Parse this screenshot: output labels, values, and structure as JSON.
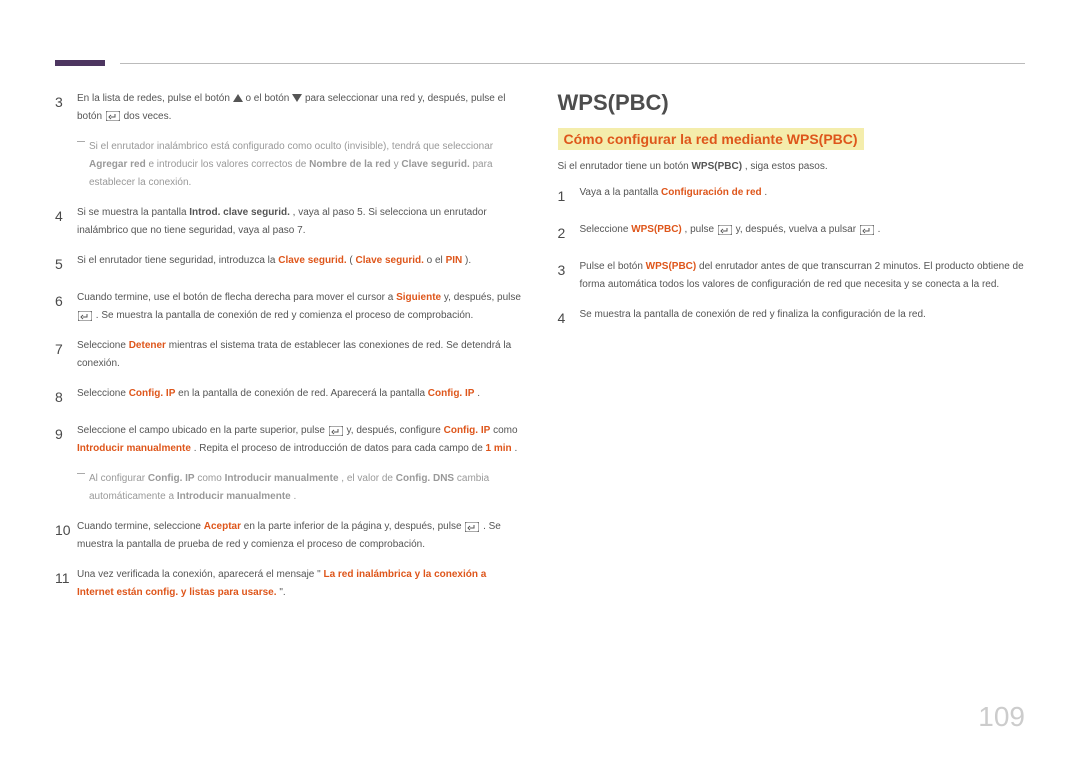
{
  "page_number": "109",
  "left": {
    "step3": {
      "pre": "En la lista de redes, pulse el botón ",
      "mid1": " o el botón ",
      "mid2": " para seleccionar una red y, después, pulse el botón ",
      "post": " dos veces."
    },
    "note1": {
      "pre": "Si el enrutador inalámbrico está configurado como oculto (invisible), tendrá que seleccionar ",
      "agregar": "Agregar red",
      "mid": " e introducir los valores correctos de ",
      "nombre": "Nombre de la red",
      "y": " y ",
      "clave": "Clave segurid.",
      "post": " para establecer la conexión."
    },
    "step4": {
      "pre": "Si se muestra la pantalla ",
      "introd": "Introd. clave segurid.",
      "post": ", vaya al paso 5. Si selecciona un enrutador inalámbrico que no tiene seguridad, vaya al paso 7."
    },
    "step5": {
      "pre": "Si el enrutador tiene seguridad, introduzca la ",
      "clave1": "Clave segurid.",
      "open": " (",
      "clave2": "Clave segurid.",
      "o": " o el ",
      "pin": "PIN",
      "close": ")."
    },
    "step6": {
      "pre": "Cuando termine, use el botón de flecha derecha para mover el cursor a ",
      "sig": "Siguiente",
      "post1": " y, después, pulse ",
      "post2": ". Se muestra la pantalla de conexión de red y comienza el proceso de comprobación."
    },
    "step7": {
      "pre": "Seleccione ",
      "det": "Detener",
      "post": " mientras el sistema trata de establecer las conexiones de red. Se detendrá la conexión."
    },
    "step8": {
      "pre": "Seleccione ",
      "cfg1": "Config. IP",
      "mid": " en la pantalla de conexión de red. Aparecerá la pantalla ",
      "cfg2": "Config. IP",
      "dot": "."
    },
    "step9": {
      "pre": "Seleccione el campo ubicado en la parte superior, pulse ",
      "mid": " y, después, configure ",
      "cfg": "Config. IP",
      "como": " como ",
      "intro": "Introducir manualmente",
      "post": ". Repita el proceso de introducción de datos para cada campo de ",
      "min": "1 min",
      "dot": "."
    },
    "note2": {
      "pre": "Al configurar ",
      "cfg1": "Config. IP",
      "como": " como ",
      "intro1": "Introducir manualmente",
      "mid": ", el valor de ",
      "dns": "Config. DNS",
      "cambia": " cambia automáticamente a ",
      "intro2": "Introducir manualmente",
      "dot": "."
    },
    "step10": {
      "pre": "Cuando termine, seleccione ",
      "acep": "Aceptar",
      "mid": " en la parte inferior de la página y, después, pulse ",
      "post": ". Se muestra la pantalla de prueba de red y comienza el proceso de comprobación."
    },
    "step11": {
      "pre": "Una vez verificada la conexión, aparecerá el mensaje \"",
      "msg": "La red inalámbrica y la conexión a Internet están config. y listas para usarse.",
      "post": "\"."
    }
  },
  "right": {
    "title": "WPS(PBC)",
    "subtitle": "Cómo configurar la red mediante WPS(PBC)",
    "intro_pre": "Si el enrutador tiene un botón ",
    "intro_bold": "WPS(PBC)",
    "intro_post": ", siga estos pasos.",
    "step1": {
      "pre": "Vaya a la pantalla ",
      "cfg": "Configuración de red",
      "dot": "."
    },
    "step2": {
      "pre": "Seleccione ",
      "wps": "WPS(PBC)",
      "mid1": ", pulse ",
      "mid2": " y, después, vuelva a pulsar ",
      "dot": "."
    },
    "step3": {
      "pre": "Pulse el botón ",
      "wps": "WPS(PBC)",
      "post": " del enrutador antes de que transcurran 2 minutos. El producto obtiene de forma automática todos los valores de configuración de red que necesita y se conecta a la red."
    },
    "step4": "Se muestra la pantalla de conexión de red y finaliza la configuración de la red."
  }
}
